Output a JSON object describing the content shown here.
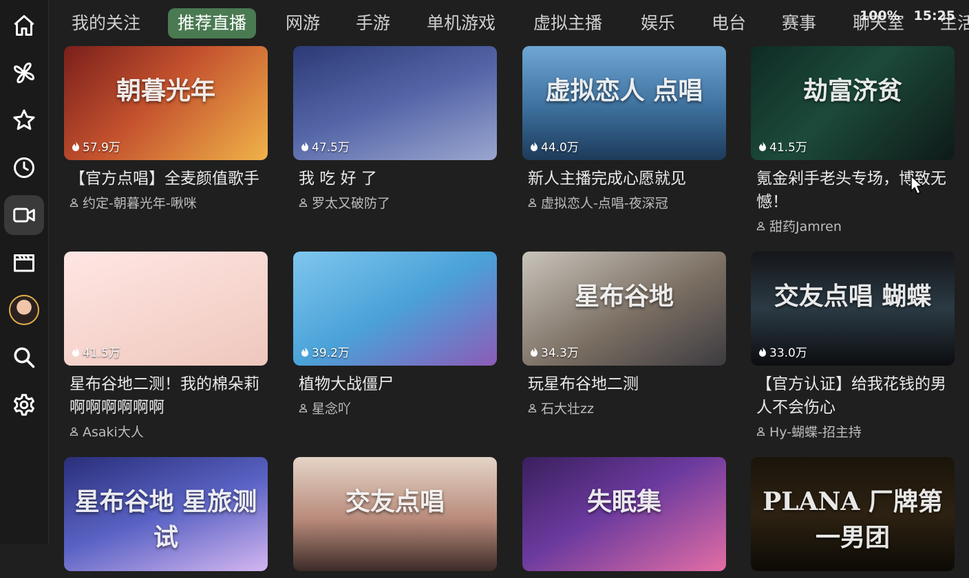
{
  "sidebar": {
    "items": [
      {
        "name": "home-icon"
      },
      {
        "name": "pinwheel-icon"
      },
      {
        "name": "star-icon"
      },
      {
        "name": "clock-icon"
      },
      {
        "name": "video-camera-icon"
      },
      {
        "name": "film-icon"
      },
      {
        "name": "avatar"
      },
      {
        "name": "search-icon"
      },
      {
        "name": "gear-icon"
      }
    ],
    "active_index": 4
  },
  "tabs": [
    {
      "label": "我的关注"
    },
    {
      "label": "推荐直播",
      "active": true
    },
    {
      "label": "网游"
    },
    {
      "label": "手游"
    },
    {
      "label": "单机游戏"
    },
    {
      "label": "虚拟主播"
    },
    {
      "label": "娱乐"
    },
    {
      "label": "电台"
    },
    {
      "label": "赛事"
    },
    {
      "label": "聊天室"
    },
    {
      "label": "生活"
    }
  ],
  "status": {
    "battery": "100%",
    "time": "15:25"
  },
  "accent_color": "#4a7a52",
  "cards": [
    {
      "viewers": "57.9万",
      "title": "【官方点唱】全麦颜值歌手",
      "owner": "约定-朝暮光年-啾咪",
      "thumb_text": "朝暮光年"
    },
    {
      "viewers": "47.5万",
      "title": "我 吃 好 了",
      "owner": "罗太又破防了",
      "thumb_text": ""
    },
    {
      "viewers": "44.0万",
      "title": "新人主播完成心愿就见",
      "owner": "虚拟恋人-点唱-夜深冠",
      "thumb_text": "虚拟恋人 点唱"
    },
    {
      "viewers": "41.5万",
      "title": "氪金剁手老头专场，博致无憾！",
      "owner": "甜药Jamren",
      "thumb_text": "劫富济贫"
    },
    {
      "viewers": "41.5万",
      "title": "星布谷地二测！我的棉朵莉啊啊啊啊啊啊",
      "owner": "Asaki大人",
      "thumb_text": ""
    },
    {
      "viewers": "39.2万",
      "title": "植物大战僵尸",
      "owner": "星念吖",
      "thumb_text": ""
    },
    {
      "viewers": "34.3万",
      "title": "玩星布谷地二测",
      "owner": "石大壮zz",
      "thumb_text": "星布谷地"
    },
    {
      "viewers": "33.0万",
      "title": "【官方认证】给我花钱的男人不会伤心",
      "owner": "Hy-蝴蝶-招主持",
      "thumb_text": "交友点唱 蝴蝶"
    },
    {
      "viewers": "",
      "title": "",
      "owner": "",
      "thumb_text": "星布谷地 星旅测试"
    },
    {
      "viewers": "",
      "title": "",
      "owner": "",
      "thumb_text": "交友点唱"
    },
    {
      "viewers": "",
      "title": "",
      "owner": "",
      "thumb_text": "失眠集"
    },
    {
      "viewers": "",
      "title": "",
      "owner": "",
      "thumb_text": "PLANA 厂牌第一男团"
    }
  ]
}
